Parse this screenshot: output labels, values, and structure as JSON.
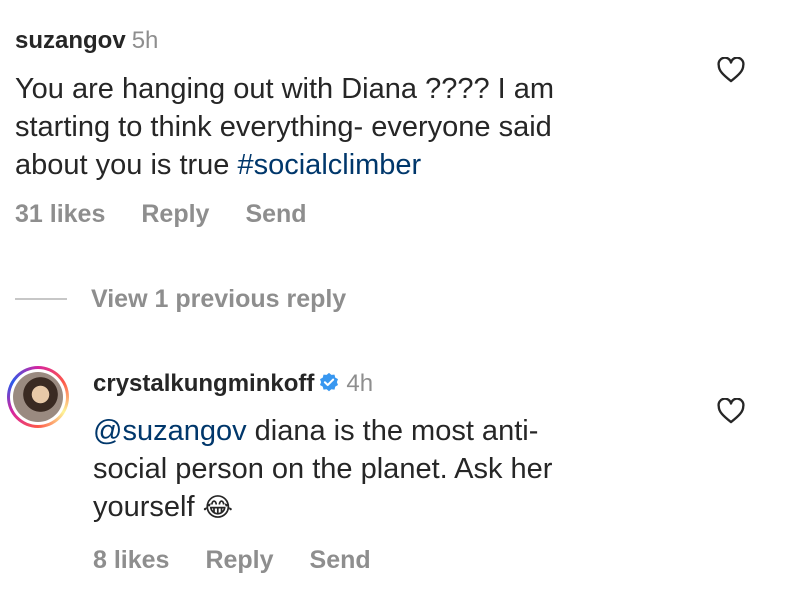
{
  "comment1": {
    "username": "suzangov",
    "time": "5h",
    "text_lines": [
      "You are hanging out with Diana ???? I am",
      "starting to think everything- everyone said",
      "about you is true "
    ],
    "hashtag": "#socialclimber",
    "likes": "31 likes",
    "reply": "Reply",
    "send": "Send"
  },
  "replies": {
    "view_previous": "View 1 previous reply"
  },
  "comment2": {
    "username": "crystalkungminkoff",
    "time": "4h",
    "mention": "@suzangov",
    "text_1": " diana is the most anti-",
    "text_2": "social person on the planet. Ask her",
    "text_3": "yourself ",
    "emoji": "😂",
    "likes": "8 likes",
    "reply": "Reply",
    "send": "Send"
  },
  "icons": {
    "like": "heart-outline-icon",
    "verified": "verified-badge-icon"
  },
  "colors": {
    "text": "#262626",
    "secondary": "#8e8e8e",
    "link": "#00376b",
    "verified": "#3897f0"
  }
}
